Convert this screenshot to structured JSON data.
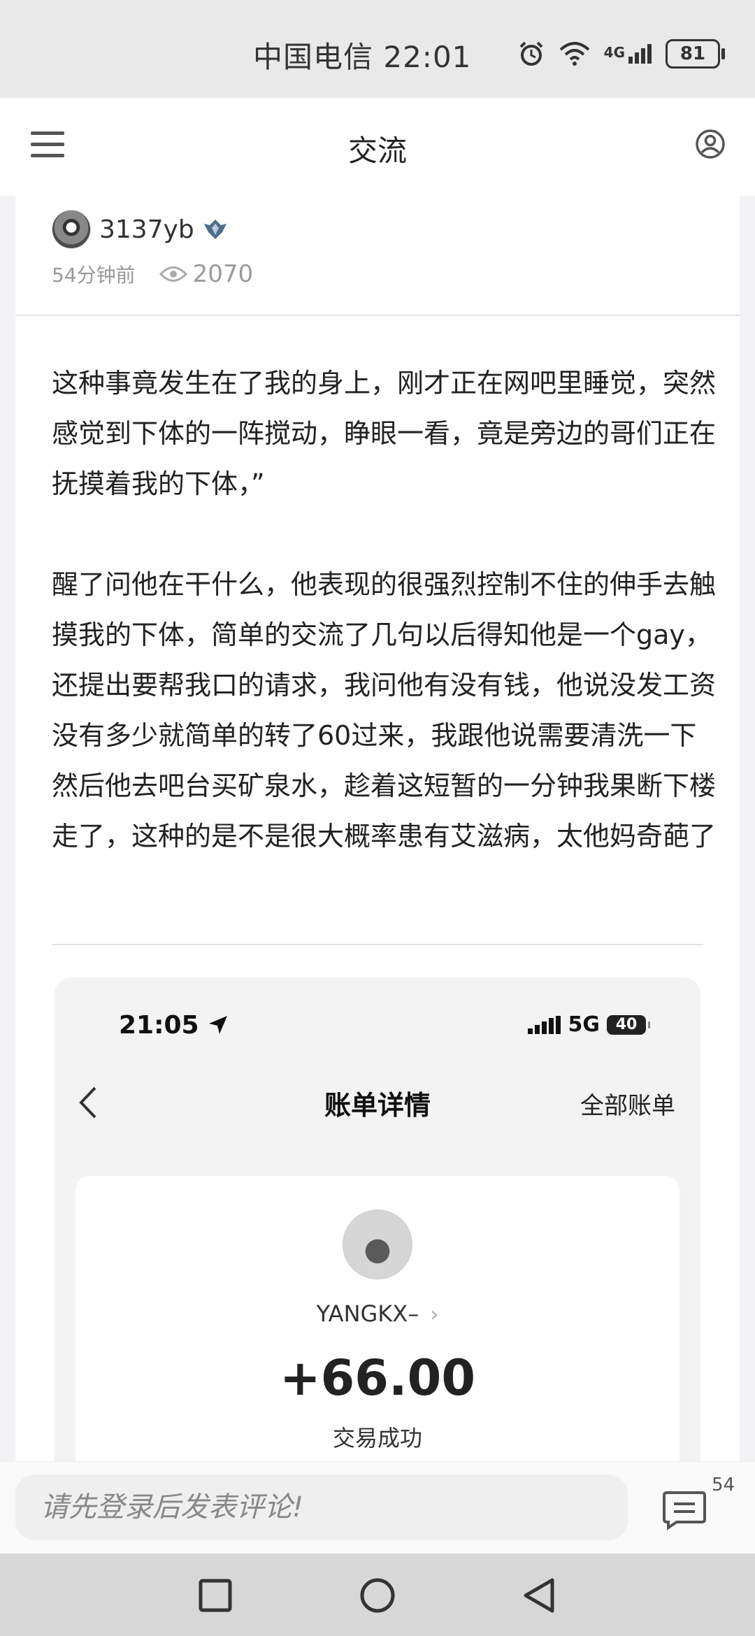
{
  "status_bar": {
    "carrier_time": "中国电信 22:01",
    "network": "4G",
    "battery": "81"
  },
  "header": {
    "title": "交流"
  },
  "post": {
    "author": "3137yb",
    "time_ago": "54分钟前",
    "views": "2070",
    "paragraphs": [
      "这种事竟发生在了我的身上，刚才正在网吧里睡觉，突然感觉到下体的一阵搅动，睁眼一看，竟是旁边的哥们正在抚摸着我的下体，”",
      "醒了问他在干什么，他表现的很强烈控制不住的伸手去触摸我的下体，简单的交流了几句以后得知他是一个gay，还提出要帮我口的请求，我问他有没有钱，他说没发工资没有多少就简单的转了60过来，我跟他说需要清洗一下然后他去吧台买矿泉水，趁着这短暂的一分钟我果断下楼走了，这种的是不是很大概率患有艾滋病，太他妈奇葩了"
    ]
  },
  "embedded_screenshot": {
    "time": "21:05",
    "network": "5G",
    "battery": "40",
    "title": "账单详情",
    "all_bills": "全部账单",
    "payer": "YANGKX–",
    "amount": "+66.00",
    "status": "交易成功"
  },
  "comment_bar": {
    "placeholder": "请先登录后发表评论!",
    "count": "54"
  }
}
